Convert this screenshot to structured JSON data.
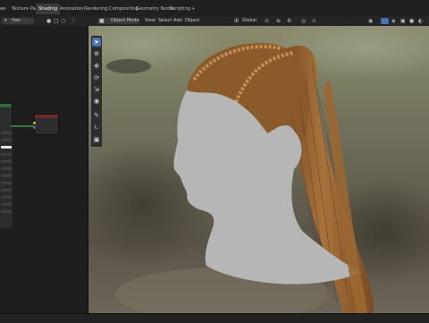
{
  "tabs": [
    "aw",
    "Texture Paint",
    "Shading",
    "Animation",
    "Rendering",
    "Compositing",
    "Geometry Nodes",
    "Scripting",
    "+"
  ],
  "active_tab": "Shading",
  "node_header": {
    "object_name": "Hair"
  },
  "viewport_header": {
    "mode": "Object Mode",
    "menus": [
      "View",
      "Select",
      "Add",
      "Object"
    ],
    "orientation": "Global"
  },
  "colors": {
    "accent": "#4772b3",
    "hair": "#8a5a2a",
    "skin": "#b6b6b6",
    "node_header": "#6a2b2b"
  },
  "toolbar_icons": [
    "select-box-icon",
    "cursor-icon",
    "move-icon",
    "rotate-icon",
    "scale-icon",
    "transform-icon",
    "annotate-icon",
    "measure-icon",
    "add-cube-icon"
  ]
}
